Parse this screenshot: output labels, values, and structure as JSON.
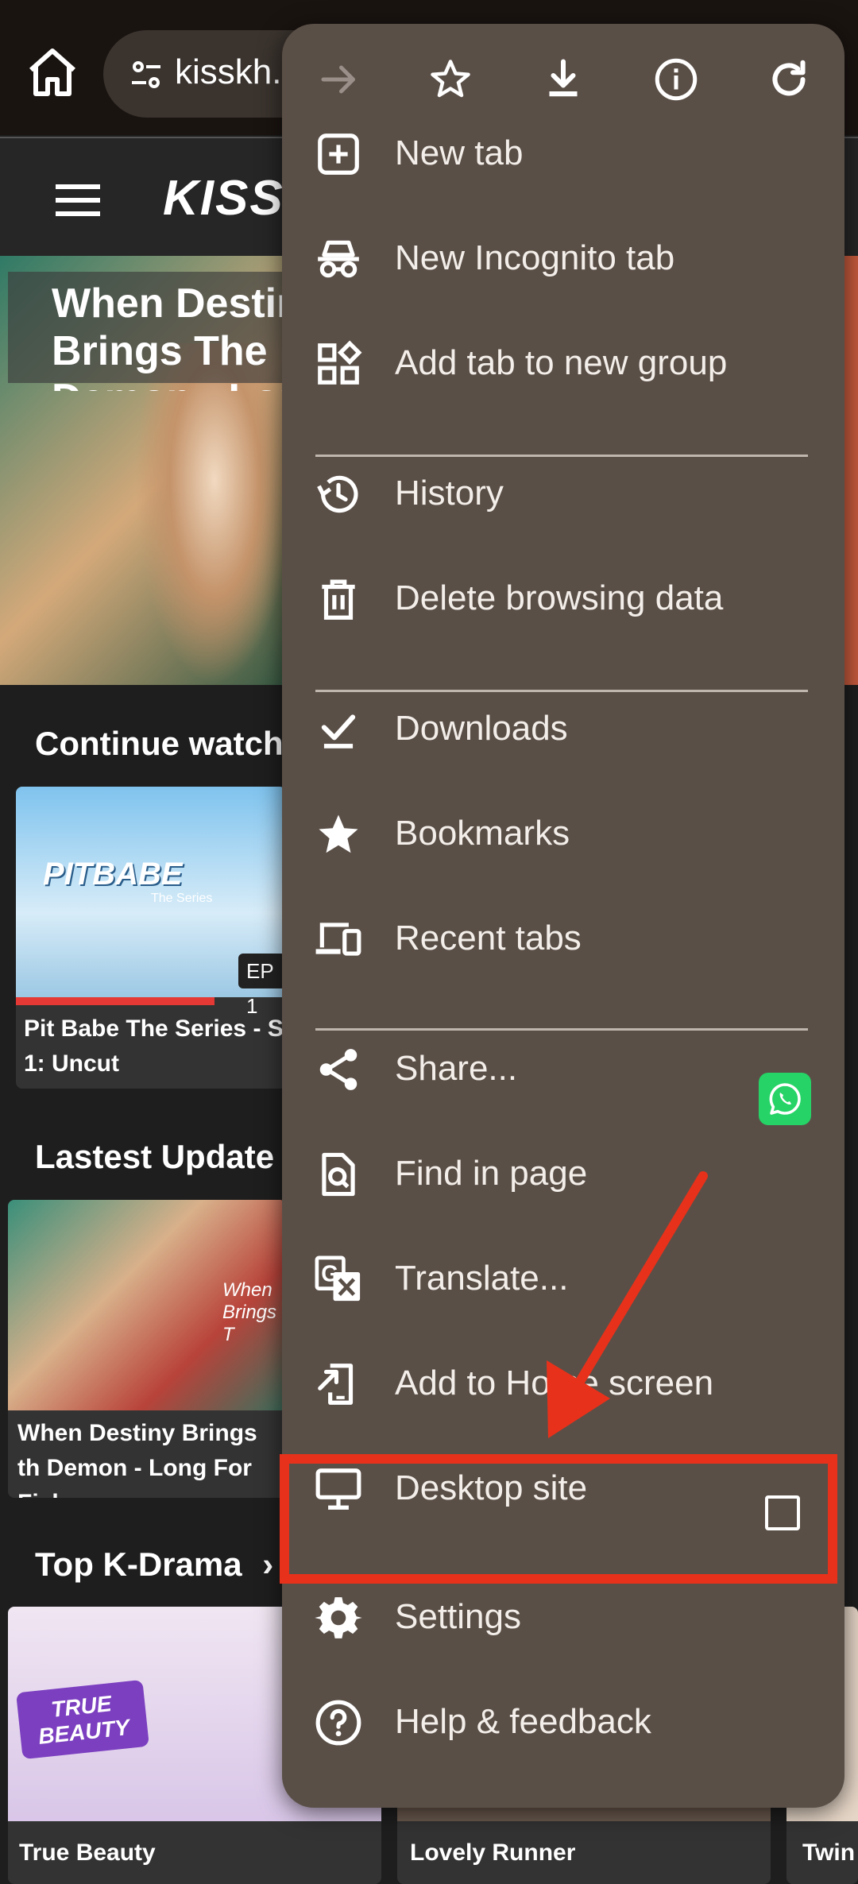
{
  "browser": {
    "url_text": "kisskh.",
    "icons": [
      "home-icon",
      "tune-icon"
    ]
  },
  "site": {
    "logo_main": "KISS",
    "hero_title": "When Destiny Brings The Demon - Long For Fish",
    "sections": {
      "continue": "Continue watchi",
      "latest": "Lastest Update",
      "topk": "Top K-Drama",
      "topk_chevron": "›"
    },
    "continue_card": {
      "image_text": "PITBABE",
      "image_subtext": "The Series",
      "ep": "EP 1",
      "caption": "Pit Babe The Series - S 1: Uncut"
    },
    "latest_card": {
      "image_text": "When Brings T",
      "caption": "When Destiny Brings th Demon - Long For Fish"
    },
    "topk_cards": [
      {
        "image_text": "TRUE BEAUTY",
        "caption": "True Beauty"
      },
      {
        "caption": "Lovely Runner"
      },
      {
        "caption": "Twin"
      }
    ]
  },
  "menu": {
    "top_icons": [
      "forward-icon",
      "star-icon",
      "download-icon",
      "info-icon",
      "refresh-icon"
    ],
    "items": [
      {
        "label": "New tab",
        "icon": "plus-box-icon"
      },
      {
        "label": "New Incognito tab",
        "icon": "incognito-icon"
      },
      {
        "label": "Add tab to new group",
        "icon": "tab-group-icon"
      },
      {
        "label": "History",
        "icon": "history-icon"
      },
      {
        "label": "Delete browsing data",
        "icon": "trash-icon"
      },
      {
        "label": "Downloads",
        "icon": "download-check-icon"
      },
      {
        "label": "Bookmarks",
        "icon": "bookmark-star-icon"
      },
      {
        "label": "Recent tabs",
        "icon": "devices-icon"
      },
      {
        "label": "Share...",
        "icon": "share-icon"
      },
      {
        "label": "Find in page",
        "icon": "find-page-icon"
      },
      {
        "label": "Translate...",
        "icon": "translate-icon"
      },
      {
        "label": "Add to Home screen",
        "icon": "add-home-icon"
      },
      {
        "label": "Desktop site",
        "icon": "monitor-icon"
      },
      {
        "label": "Settings",
        "icon": "gear-icon"
      },
      {
        "label": "Help & feedback",
        "icon": "help-icon"
      }
    ]
  },
  "colors": {
    "menu_bg": "#5a4f47",
    "annotation": "#e8311a",
    "whatsapp": "#25d366"
  }
}
